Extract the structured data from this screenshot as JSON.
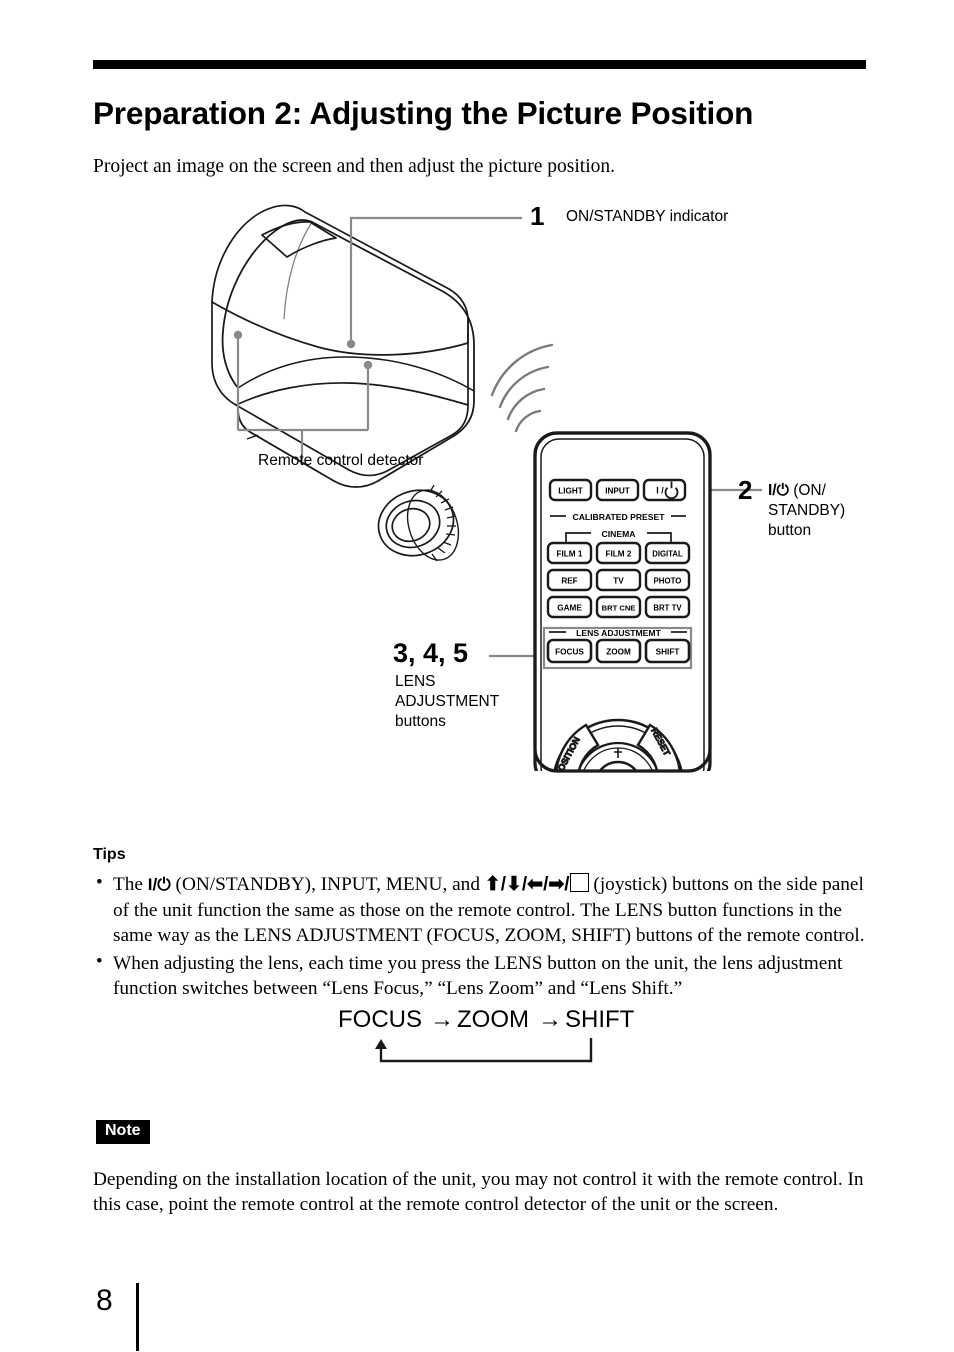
{
  "document": {
    "title": "Preparation 2: Adjusting the Picture Position",
    "intro": "Project an image on the screen and then adjust the picture position.",
    "page_number": "8"
  },
  "figure": {
    "callouts": [
      {
        "number": "1",
        "label": "ON/STANDBY indicator"
      },
      {
        "number": "2",
        "label_line1_prefix": "I/",
        "label_line1_suffix": " (ON/",
        "label_line2": "STANDBY)",
        "label_line3": "button"
      },
      {
        "number": "3, 4, 5",
        "label_line1": "LENS",
        "label_line2": "ADJUSTMENT",
        "label_line3": "buttons"
      }
    ],
    "projector": {
      "detector_label": "Remote control detector"
    },
    "remote": {
      "top_row": [
        "LIGHT",
        "INPUT",
        "I / ⏻"
      ],
      "group_calibrated_preset": "CALIBRATED PRESET",
      "group_cinema": "CINEMA",
      "preset_rows": [
        [
          "FILM 1",
          "FILM 2",
          "DIGITAL"
        ],
        [
          "REF",
          "TV",
          "PHOTO"
        ],
        [
          "GAME",
          "BRT CNE",
          "BRT TV"
        ]
      ],
      "group_lens_adjustment": "LENS ADJUSTMEMT",
      "lens_buttons": [
        "FOCUS",
        "ZOOM",
        "SHIFT"
      ],
      "wheel_left": "POSITION",
      "wheel_right": "RESET"
    }
  },
  "tips": {
    "heading": "Tips",
    "item1": {
      "part1": "The ",
      "power_glyph": "I/⏻",
      "part2": " (ON/STANDBY), INPUT, MENU, and ",
      "arrows": "⬆/⬇/⬅/➡/",
      "part3": " (joystick) buttons on the side panel of the unit function the same as those on the remote control. The LENS button functions in the same way as the LENS ADJUSTMENT (FOCUS, ZOOM, SHIFT) buttons of the remote control."
    },
    "item2": "When adjusting the lens, each time you press the LENS button on the unit, the lens adjustment function switches between “Lens Focus,” “Lens Zoom” and “Lens Shift.”"
  },
  "flow": {
    "step1": "FOCUS",
    "arrow1": "→",
    "step2": "ZOOM",
    "arrow2": "→",
    "step3": "SHIFT"
  },
  "note": {
    "badge": "Note",
    "body": "Depending on the installation location of the unit, you may not control it with the remote control. In this case, point the remote control at the remote control detector of the unit or the screen."
  },
  "colors": {
    "ink": "#000000",
    "leader": "#7a7a7a",
    "paper": "#ffffff"
  }
}
